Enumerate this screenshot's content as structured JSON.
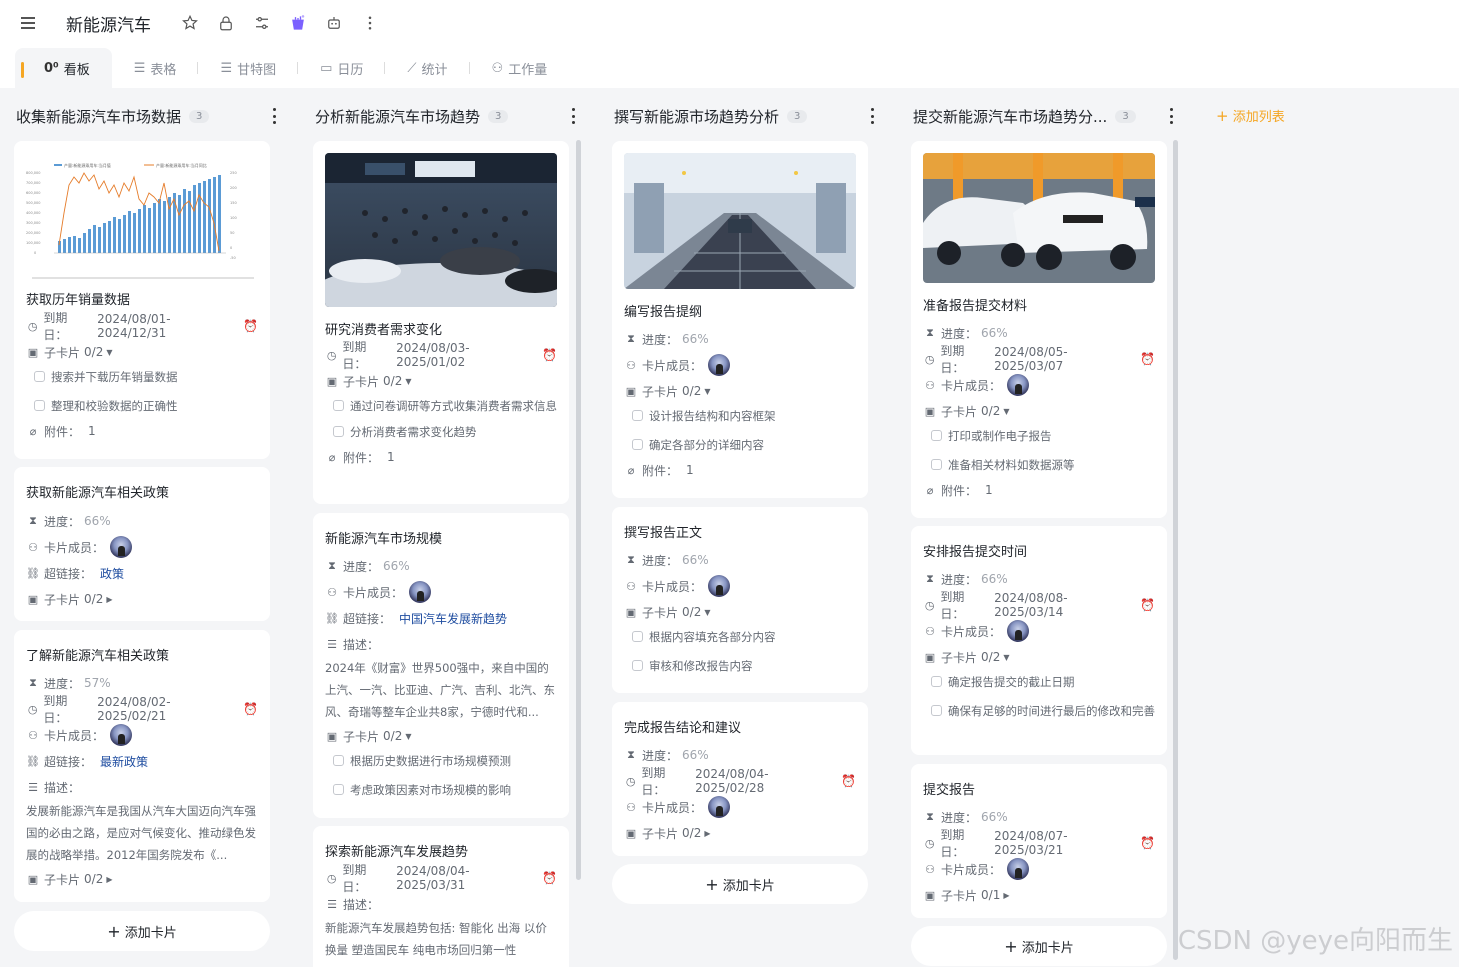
{
  "header": {
    "title": "新能源汽车",
    "tabs": [
      {
        "label": "看板",
        "icon": "kanban-icon"
      },
      {
        "label": "表格",
        "icon": "table-icon"
      },
      {
        "label": "甘特图",
        "icon": "gantt-icon"
      },
      {
        "label": "日历",
        "icon": "calendar-icon"
      },
      {
        "label": "统计",
        "icon": "chart-icon"
      },
      {
        "label": "工作量",
        "icon": "workload-icon"
      }
    ]
  },
  "labels": {
    "due": "到期日：",
    "subcards": "子卡片",
    "attach": "附件：",
    "progress": "进度：",
    "members": "卡片成员：",
    "link": "超链接：",
    "desc": "描述：",
    "add_card": "添加卡片",
    "add_list": "添加列表"
  },
  "columns": [
    {
      "title": "收集新能源汽车市场数据",
      "count": "3",
      "cards": [
        {
          "title": "获取历年销量数据",
          "due": "2024/08/01-2024/12/31",
          "sub": "0/2",
          "tasks": [
            "搜索并下载历年销量数据",
            "整理和校验数据的正确性"
          ],
          "attach": "1",
          "chart": {
            "legend": [
              "产量:新能源乘用车:当月值",
              "产量:新能源乘用车:当月同比"
            ],
            "yleft": [
              "800,000",
              "700,000",
              "600,000",
              "500,000",
              "400,000",
              "300,000",
              "200,000",
              "100,000",
              "0"
            ],
            "yright": [
              "250",
              "200",
              "150",
              "100",
              "50",
              "0",
              "-50"
            ]
          }
        },
        {
          "title": "获取新能源汽车相关政策",
          "progress": "66%",
          "link": "政策",
          "sub": "0/2"
        },
        {
          "title": "了解新能源汽车相关政策",
          "progress": "57%",
          "due": "2024/08/02-2025/02/21",
          "link": "最新政策",
          "desc": "发展新能源汽车是我国从汽车大国迈向汽车强国的必由之路，是应对气候变化、推动绿色发展的战略举措。2012年国务院发布《...",
          "sub": "0/2"
        }
      ]
    },
    {
      "title": "分析新能源汽车市场趋势",
      "count": "3",
      "cards": [
        {
          "title": "研究消费者需求变化",
          "due": "2024/08/03-2025/01/02",
          "sub": "0/2",
          "tasks": [
            "通过问卷调研等方式收集消费者需求信息",
            "分析消费者需求变化趋势"
          ],
          "attach": "1"
        },
        {
          "title": "新能源汽车市场规模",
          "progress": "66%",
          "link": "中国汽车发展新趋势",
          "desc": "2024年《财富》世界500强中，来自中国的上汽、一汽、比亚迪、广汽、吉利、北汽、东风、奇瑞等整车企业共8家，宁德时代和...",
          "sub": "0/2",
          "tasks": [
            "根据历史数据进行市场规模预测",
            "考虑政策因素对市场规模的影响"
          ]
        },
        {
          "title": "探索新能源汽车发展趋势",
          "due": "2024/08/04-2025/03/31",
          "desc": "新能源汽车发展趋势包括: 智能化 出海 以价换量 塑造国民车 纯电市场回归第一性"
        }
      ]
    },
    {
      "title": "撰写新能源市场趋势分析",
      "count": "3",
      "cards": [
        {
          "title": "编写报告提纲",
          "progress": "66%",
          "sub": "0/2",
          "tasks": [
            "设计报告结构和内容框架",
            "确定各部分的详细内容"
          ],
          "attach": "1"
        },
        {
          "title": "撰写报告正文",
          "progress": "66%",
          "sub": "0/2",
          "tasks": [
            "根据内容填充各部分内容",
            "审核和修改报告内容"
          ]
        },
        {
          "title": "完成报告结论和建议",
          "progress": "66%",
          "due": "2024/08/04-2025/02/28",
          "sub": "0/2"
        }
      ]
    },
    {
      "title": "提交新能源汽车市场趋势分...",
      "count": "3",
      "cards": [
        {
          "title": "准备报告提交材料",
          "progress": "66%",
          "due": "2024/08/05-2025/03/07",
          "sub": "0/2",
          "tasks": [
            "打印或制作电子报告",
            "准备相关材料如数据源等"
          ],
          "attach": "1"
        },
        {
          "title": "安排报告提交时间",
          "progress": "66%",
          "due": "2024/08/08-2025/03/14",
          "sub": "0/2",
          "tasks": [
            "确定报告提交的截止日期",
            "确保有足够的时间进行最后的修改和完善"
          ]
        },
        {
          "title": "提交报告",
          "progress": "66%",
          "due": "2024/08/07-2025/03/21",
          "sub": "0/1"
        }
      ]
    }
  ],
  "watermark": "CSDN @yeye向阳而生"
}
